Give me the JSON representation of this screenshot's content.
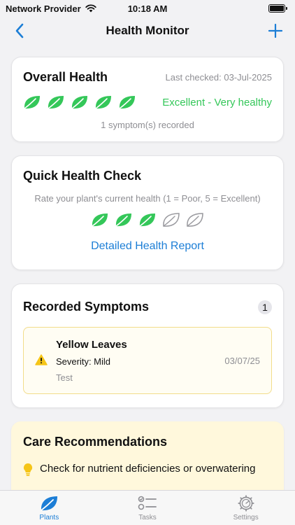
{
  "status_bar": {
    "carrier": "Network Provider",
    "time": "10:18 AM"
  },
  "nav": {
    "title": "Health Monitor"
  },
  "overall": {
    "title": "Overall Health",
    "last_checked": "Last checked: 03-Jul-2025",
    "rating": 5,
    "max_rating": 5,
    "status": "Excellent - Very healthy",
    "symptom_count_text": "1 symptom(s) recorded"
  },
  "quick_check": {
    "title": "Quick Health Check",
    "subtitle": "Rate your plant's current health (1 = Poor, 5 = Excellent)",
    "rating": 3,
    "max_rating": 5,
    "detail_link": "Detailed Health Report"
  },
  "symptoms": {
    "title": "Recorded Symptoms",
    "count": "1",
    "items": [
      {
        "name": "Yellow Leaves",
        "severity": "Severity: Mild",
        "note": "Test",
        "date": "03/07/25"
      }
    ]
  },
  "recommendations": {
    "title": "Care Recommendations",
    "items": [
      {
        "text": "Check for nutrient deficiencies or overwatering"
      }
    ]
  },
  "tabs": [
    {
      "label": "Plants",
      "icon": "leaf-icon",
      "active": true
    },
    {
      "label": "Tasks",
      "icon": "checklist-icon",
      "active": false
    },
    {
      "label": "Settings",
      "icon": "gear-icon",
      "active": false
    }
  ],
  "colors": {
    "accent": "#1c7ed6",
    "healthy": "#34c759",
    "inactive": "#8e8e93",
    "warning": "#f5c518"
  }
}
